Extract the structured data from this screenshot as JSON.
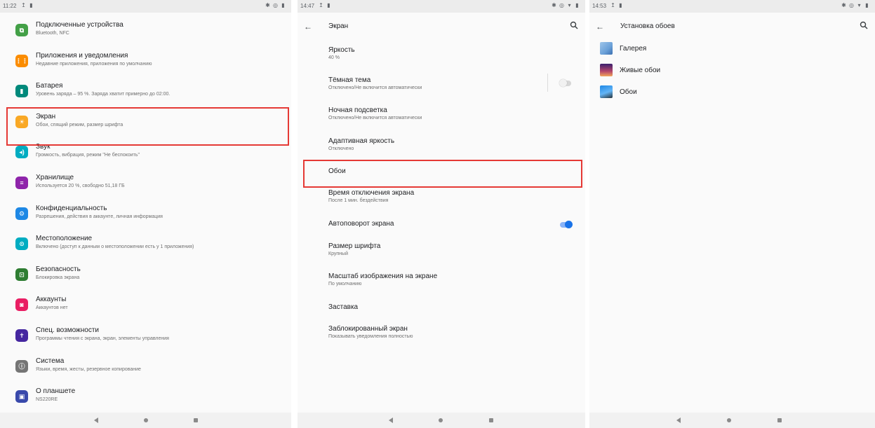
{
  "panel1": {
    "status": {
      "time": "11:22"
    },
    "items": [
      {
        "title": "Подключенные устройства",
        "subtitle": "Bluetooth, NFC",
        "color": "#43a047",
        "icon": "devices-icon"
      },
      {
        "title": "Приложения и уведомления",
        "subtitle": "Недавние приложения, приложения по умолчанию",
        "color": "#fb8c00",
        "icon": "apps-icon"
      },
      {
        "title": "Батарея",
        "subtitle": "Уровень заряда – 95 %. Заряда хватит примерно до 02:00.",
        "color": "#00897b",
        "icon": "battery-icon"
      },
      {
        "title": "Экран",
        "subtitle": "Обои, спящий режим, размер шрифта",
        "color": "#f9a825",
        "icon": "brightness-icon"
      },
      {
        "title": "Звук",
        "subtitle": "Громкость, вибрация, режим \"Не беспокоить\"",
        "color": "#00acc1",
        "icon": "volume-icon"
      },
      {
        "title": "Хранилище",
        "subtitle": "Используется 20 %, свободно 51,18 ГБ",
        "color": "#8e24aa",
        "icon": "storage-icon"
      },
      {
        "title": "Конфиденциальность",
        "subtitle": "Разрешения, действия в аккаунте, личная информация",
        "color": "#1e88e5",
        "icon": "privacy-icon"
      },
      {
        "title": "Местоположение",
        "subtitle": "Включено (доступ к данным о местоположении есть у 1 приложения)",
        "color": "#00acc1",
        "icon": "location-icon"
      },
      {
        "title": "Безопасность",
        "subtitle": "Блокировка экрана",
        "color": "#2e7d32",
        "icon": "lock-icon"
      },
      {
        "title": "Аккаунты",
        "subtitle": "Аккаунтов нет",
        "color": "#e91e63",
        "icon": "account-icon"
      },
      {
        "title": "Спец. возможности",
        "subtitle": "Программы чтения с экрана, экран, элементы управления",
        "color": "#4527a0",
        "icon": "accessibility-icon"
      },
      {
        "title": "Система",
        "subtitle": "Языки, время, жесты, резервное копирование",
        "color": "#757575",
        "icon": "info-icon"
      },
      {
        "title": "О планшете",
        "subtitle": "NS220RE",
        "color": "#3949ab",
        "icon": "tablet-icon"
      }
    ]
  },
  "panel2": {
    "status": {
      "time": "14:47"
    },
    "title": "Экран",
    "items": [
      {
        "title": "Яркость",
        "subtitle": "40 %"
      },
      {
        "title": "Тёмная тема",
        "subtitle": "Отключено/Не включится автоматически",
        "toggle": "off"
      },
      {
        "title": "Ночная подсветка",
        "subtitle": "Отключено/Не включится автоматически"
      },
      {
        "title": "Адаптивная яркость",
        "subtitle": "Отключено"
      },
      {
        "title": "Обои",
        "subtitle": ""
      },
      {
        "title": "Время отключения экрана",
        "subtitle": "После 1 мин. бездействия"
      },
      {
        "title": "Автоповорот экрана",
        "subtitle": "",
        "toggle": "on"
      },
      {
        "title": "Размер шрифта",
        "subtitle": "Крупный"
      },
      {
        "title": "Масштаб изображения на экране",
        "subtitle": "По умолчанию"
      },
      {
        "title": "Заставка",
        "subtitle": ""
      },
      {
        "title": "Заблокированный экран",
        "subtitle": "Показывать уведомления полностью"
      }
    ]
  },
  "panel3": {
    "status": {
      "time": "14:53"
    },
    "title": "Установка обоев",
    "items": [
      {
        "title": "Галерея",
        "icon": "gallery-icon"
      },
      {
        "title": "Живые обои",
        "icon": "live-wallpaper-icon"
      },
      {
        "title": "Обои",
        "icon": "wallpapers-icon"
      }
    ]
  },
  "colors": {
    "highlight": "#e53935",
    "accent": "#1a73e8"
  }
}
